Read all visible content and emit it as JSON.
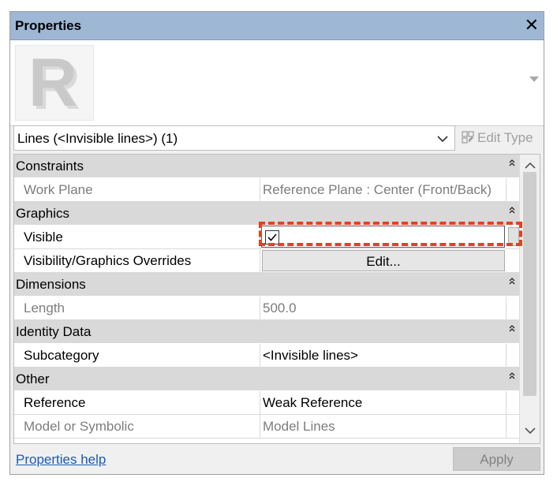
{
  "window": {
    "title": "Properties",
    "close_symbol": "✕"
  },
  "preview": {
    "logo_letter": "R"
  },
  "type_selector": {
    "value": "Lines (<Invisible lines>) (1)",
    "edit_type_label": "Edit Type"
  },
  "sections": [
    {
      "label": "Constraints",
      "rows": [
        {
          "name": "Work Plane",
          "value": "Reference Plane : Center (Front/Back)",
          "greyed": true
        }
      ]
    },
    {
      "label": "Graphics",
      "rows": [
        {
          "name": "Visible",
          "checked": true
        },
        {
          "name": "Visibility/Graphics Overrides",
          "button_label": "Edit..."
        }
      ]
    },
    {
      "label": "Dimensions",
      "rows": [
        {
          "name": "Length",
          "value": "500.0",
          "greyed": true
        }
      ]
    },
    {
      "label": "Identity Data",
      "rows": [
        {
          "name": "Subcategory",
          "value": "<Invisible lines>"
        }
      ]
    },
    {
      "label": "Other",
      "rows": [
        {
          "name": "Reference",
          "value": "Weak Reference"
        },
        {
          "name": "Model or Symbolic",
          "value": "Model Lines",
          "greyed": true
        }
      ]
    }
  ],
  "footer": {
    "help_link": "Properties help",
    "apply_label": "Apply"
  },
  "colors": {
    "titlebar": "#9db7d5",
    "section_bg": "#d9d9d9",
    "highlight": "#e2421d",
    "link": "#1a5bb5"
  }
}
